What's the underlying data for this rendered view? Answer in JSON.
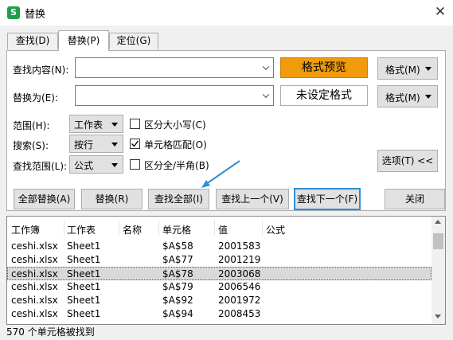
{
  "window": {
    "title": "替换",
    "app_icon_letter": "S"
  },
  "tabs": [
    {
      "label": "查找(D)",
      "active": false
    },
    {
      "label": "替换(P)",
      "active": true
    },
    {
      "label": "定位(G)",
      "active": false
    }
  ],
  "find": {
    "label": "查找内容(N):",
    "value": "",
    "preview_label": "格式预览",
    "format_button": "格式(M)",
    "preview_color": "#f09a0c"
  },
  "replace": {
    "label": "替换为(E):",
    "value": "",
    "preview_label": "未设定格式",
    "format_button": "格式(M)"
  },
  "options": {
    "scope": {
      "label": "范围(H):",
      "value": "工作表"
    },
    "search": {
      "label": "搜索(S):",
      "value": "按行"
    },
    "look_in": {
      "label": "查找范围(L):",
      "value": "公式"
    },
    "match_case": {
      "label": "区分大小写(C)",
      "checked": false
    },
    "match_cell": {
      "label": "单元格匹配(O)",
      "checked": true
    },
    "match_width": {
      "label": "区分全/半角(B)",
      "checked": false
    },
    "toggle_button": "选项(T) <<"
  },
  "actions": {
    "replace_all": "全部替换(A)",
    "replace": "替换(R)",
    "find_all": "查找全部(I)",
    "find_prev": "查找上一个(V)",
    "find_next": "查找下一个(F)",
    "close": "关闭"
  },
  "results": {
    "columns": [
      "工作簿",
      "工作表",
      "名称",
      "单元格",
      "值",
      "公式"
    ],
    "rows": [
      {
        "workbook": "ceshi.xlsx",
        "sheet": "Sheet1",
        "name": "",
        "cell": "$A$58",
        "value": "2001583",
        "formula": ""
      },
      {
        "workbook": "ceshi.xlsx",
        "sheet": "Sheet1",
        "name": "",
        "cell": "$A$77",
        "value": "2001219",
        "formula": ""
      },
      {
        "workbook": "ceshi.xlsx",
        "sheet": "Sheet1",
        "name": "",
        "cell": "$A$78",
        "value": "2003068",
        "formula": ""
      },
      {
        "workbook": "ceshi.xlsx",
        "sheet": "Sheet1",
        "name": "",
        "cell": "$A$79",
        "value": "2006546",
        "formula": ""
      },
      {
        "workbook": "ceshi.xlsx",
        "sheet": "Sheet1",
        "name": "",
        "cell": "$A$92",
        "value": "2001972",
        "formula": ""
      },
      {
        "workbook": "ceshi.xlsx",
        "sheet": "Sheet1",
        "name": "",
        "cell": "$A$94",
        "value": "2008453",
        "formula": ""
      }
    ],
    "selected_row": 2
  },
  "status": "570 个单元格被找到",
  "colors": {
    "accent": "#2e8fd6",
    "arrow": "#2e8fd6",
    "selected_row": "#d9d9d9"
  }
}
